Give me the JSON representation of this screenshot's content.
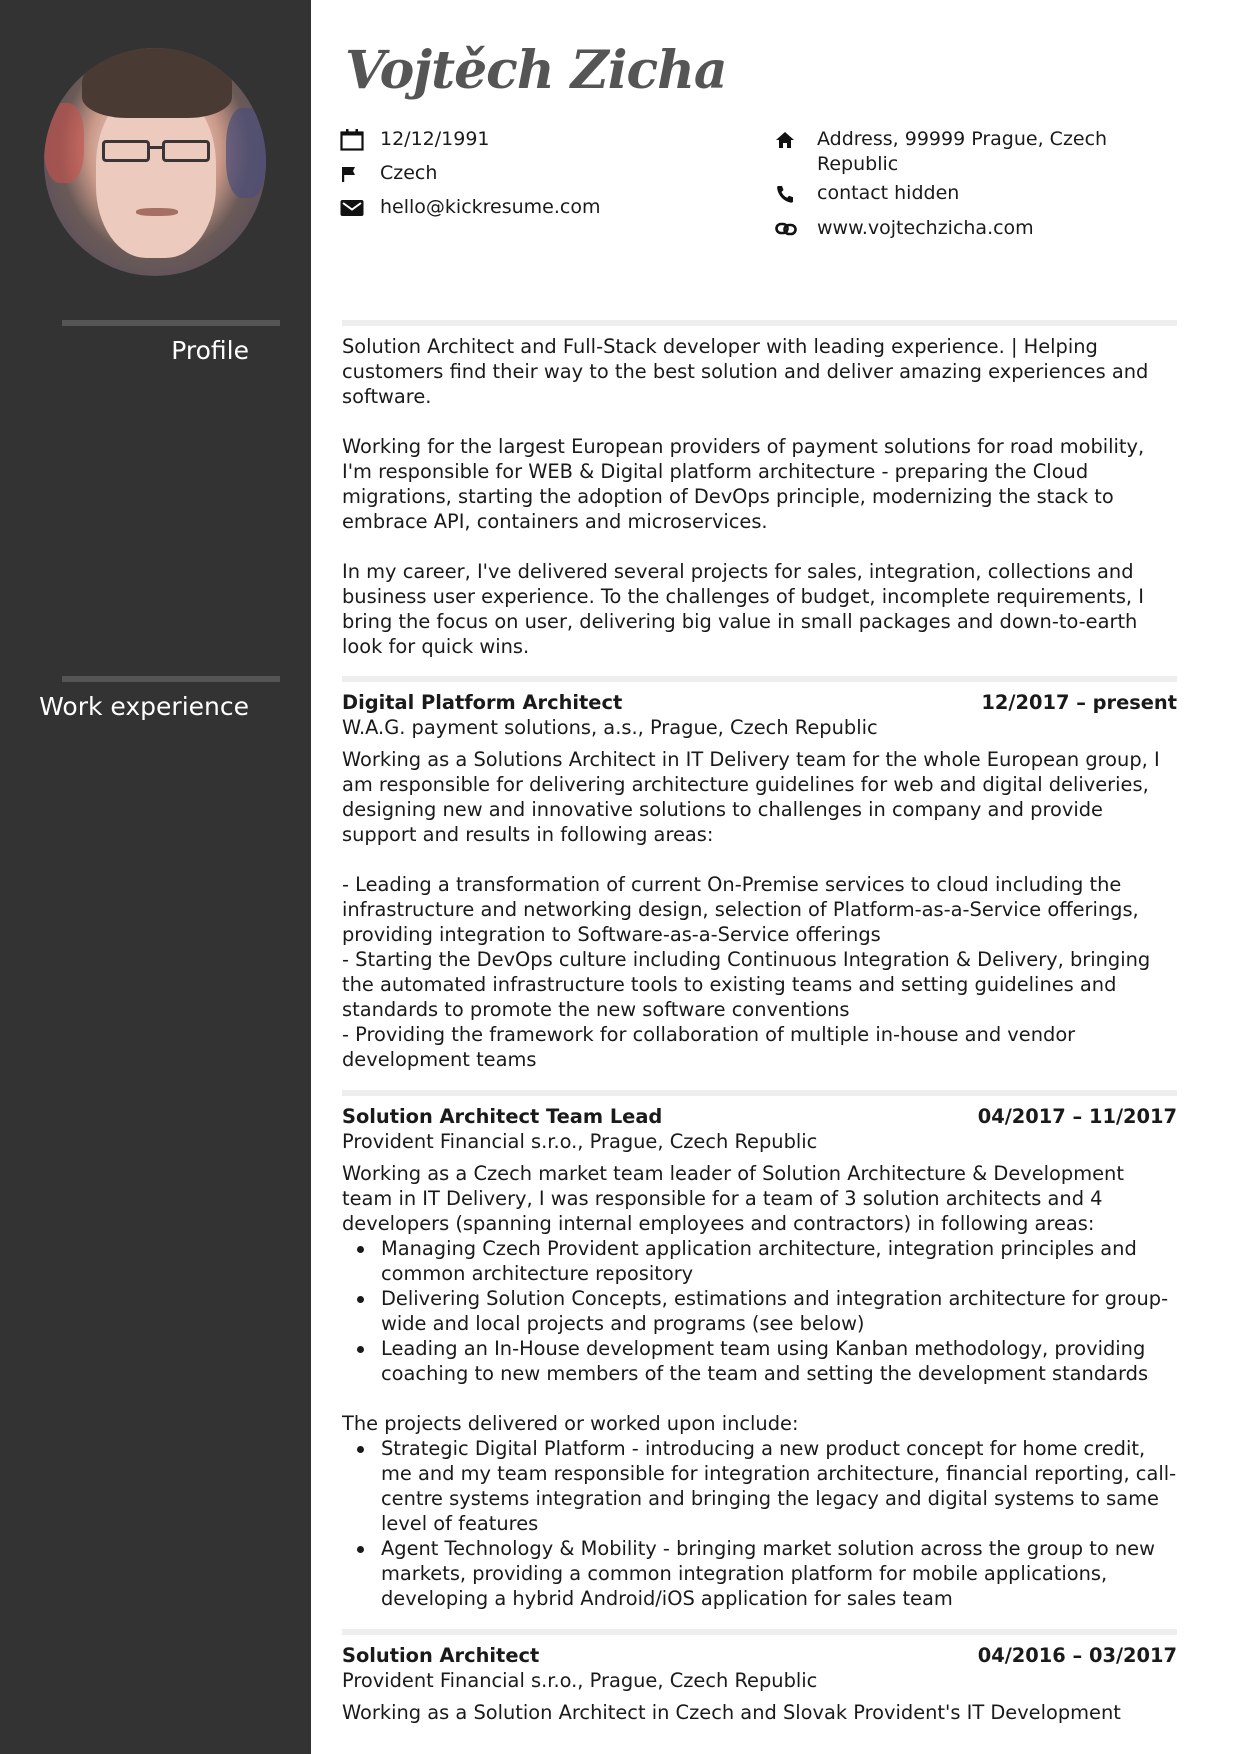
{
  "header": {
    "name": "Vojtěch Zicha",
    "contacts_left": [
      {
        "icon": "calendar-icon",
        "value": "12/12/1991"
      },
      {
        "icon": "flag-icon",
        "value": "Czech"
      },
      {
        "icon": "envelope-icon",
        "value": "hello@kickresume.com"
      }
    ],
    "contacts_right": [
      {
        "icon": "home-icon",
        "value": "Address, 99999 Prague, Czech Republic"
      },
      {
        "icon": "phone-icon",
        "value": "contact hidden"
      },
      {
        "icon": "link-icon",
        "value": "www.vojtechzicha.com"
      }
    ]
  },
  "colors": {
    "sidebar": "#333333",
    "sidebar_rule": "#555555",
    "divider": "#eeeeee",
    "name": "#555555",
    "text": "#1a1a1a"
  },
  "sections": {
    "profile": {
      "heading": "Profile",
      "paragraphs": [
        "Solution Architect and Full-Stack developer with leading experience. | Helping customers find their way to the best solution and deliver amazing experiences and software.",
        "Working for the largest European providers of payment solutions for road mobility, I'm responsible for WEB & Digital platform architecture - preparing the Cloud migrations, starting the adoption of DevOps principle, modernizing the stack to embrace API, containers and microservices.",
        "In my career, I've delivered several projects for sales, integration, collections and business user experience. To the challenges of budget, incomplete requirements, I bring the focus on user, delivering big value in small packages and down-to-earth look for quick wins."
      ]
    },
    "work": {
      "heading": "Work experience",
      "jobs": [
        {
          "title": "Digital Platform Architect",
          "dates": "12/2017 – present",
          "company": "W.A.G. payment solutions, a.s., Prague, Czech Republic",
          "intro": "Working as a Solutions Architect in IT Delivery team for the whole European group, I am responsible for delivering architecture guidelines for web and digital deliveries, designing new and innovative solutions to challenges in company and provide support and results in following areas:",
          "lines": [
            "- Leading a transformation of current On-Premise services to cloud including the infrastructure and networking design, selection of Platform-as-a-Service offerings, providing integration to Software-as-a-Service offerings",
            "- Starting the DevOps culture including Continuous Integration & Delivery, bringing the automated infrastructure tools to existing teams and setting guidelines and standards to promote the new software conventions",
            "- Providing the framework for collaboration of multiple in-house and vendor development teams"
          ]
        },
        {
          "title": "Solution Architect Team Lead",
          "dates": "04/2017 – 11/2017",
          "company": "Provident Financial s.r.o., Prague, Czech Republic",
          "intro": "Working as a Czech market team leader of Solution Architecture & Development team in IT Delivery, I was responsible for a team of 3 solution architects and 4 developers (spanning internal employees and contractors) in following areas:",
          "bullets": [
            "Managing Czech Provident application architecture, integration principles and common architecture repository",
            "Delivering Solution Concepts, estimations and integration architecture for group-wide and local projects and programs (see below)",
            "Leading an In-House development team using Kanban methodology, providing coaching to new members of the team and setting the development standards"
          ],
          "projects_intro": "The projects delivered or worked upon include:",
          "projects": [
            "Strategic Digital Platform - introducing a new product concept for home credit, me and my team responsible for integration architecture, financial reporting, call-centre systems integration and bringing the legacy and digital systems to same level of features",
            "Agent Technology & Mobility - bringing market solution across the group to new markets, providing a common integration platform for mobile applications, developing a hybrid Android/iOS application for sales team"
          ]
        },
        {
          "title": "Solution Architect",
          "dates": "04/2016 – 03/2017",
          "company": "Provident Financial s.r.o., Prague, Czech Republic",
          "intro": "Working as a Solution Architect in Czech and Slovak Provident's IT Development"
        }
      ]
    }
  }
}
